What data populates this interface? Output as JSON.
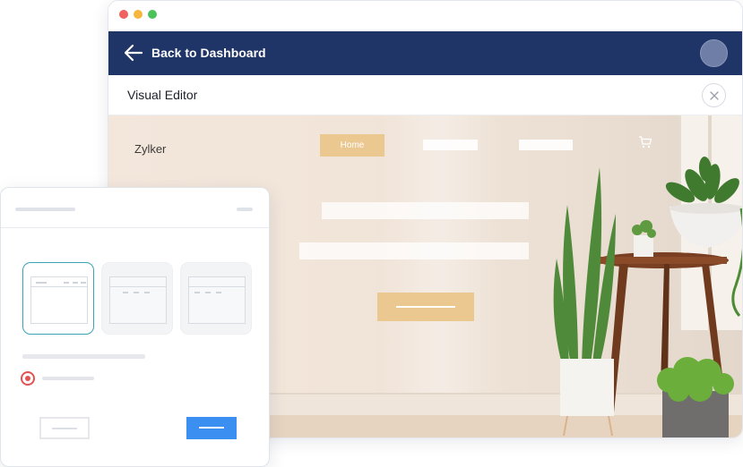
{
  "header": {
    "back_label": "Back to Dashboard"
  },
  "editor": {
    "title": "Visual Editor"
  },
  "site": {
    "brand": "Zylker",
    "nav_home": "Home"
  },
  "colors": {
    "header_bg": "#1f3467",
    "accent_gold": "#ecc891",
    "primary_blue": "#3b8ff0",
    "selected_teal": "#39a4b6",
    "radio_red": "#e15454"
  },
  "icons": {
    "back": "arrow-left-icon",
    "close": "close-icon",
    "cart": "cart-icon"
  }
}
